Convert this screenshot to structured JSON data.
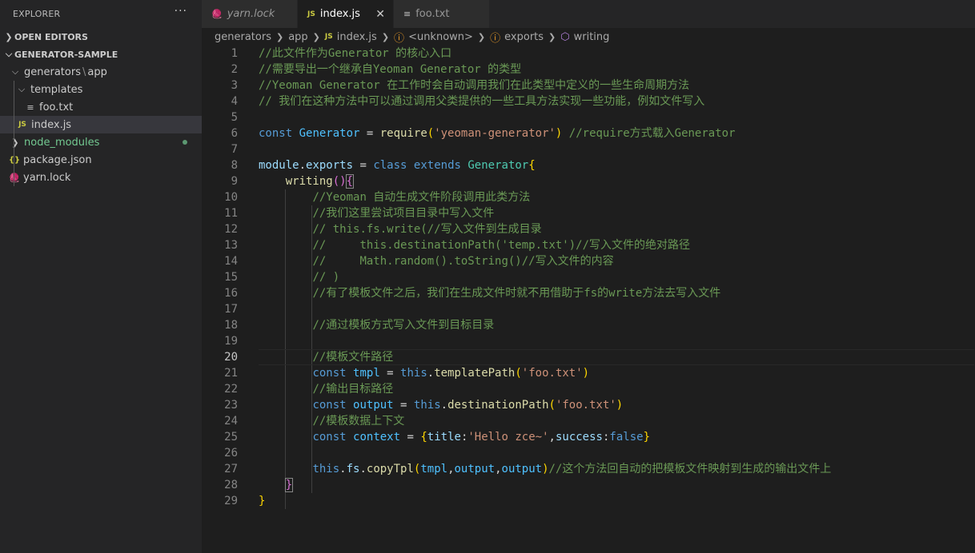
{
  "explorer": {
    "title": "EXPLORER",
    "more": "···",
    "open_editors": "OPEN EDITORS",
    "project": "GENERATOR-SAMPLE",
    "tree": {
      "generators": "generators",
      "sep": "\\",
      "app": "app",
      "templates": "templates",
      "foo_txt": "foo.txt",
      "index_js": "index.js",
      "node_modules": "node_modules",
      "package_json": "package.json",
      "yarn_lock": "yarn.lock"
    }
  },
  "tabs": [
    {
      "label": "yarn.lock",
      "icon": "yarn-icon"
    },
    {
      "label": "index.js",
      "icon": "js-icon",
      "close": "✕"
    },
    {
      "label": "foo.txt",
      "icon": "text-file-icon"
    }
  ],
  "breadcrumb": [
    "generators",
    "app",
    "index.js",
    "<unknown>",
    "exports",
    "writing"
  ],
  "icons": {
    "js": "JS",
    "json": "{}",
    "txt": "≡"
  },
  "editor": {
    "line_numbers": [
      "1",
      "2",
      "3",
      "4",
      "5",
      "6",
      "7",
      "8",
      "9",
      "10",
      "11",
      "12",
      "13",
      "14",
      "15",
      "16",
      "17",
      "18",
      "19",
      "20",
      "21",
      "22",
      "23",
      "24",
      "25",
      "26",
      "27",
      "28",
      "29"
    ],
    "lines": {
      "l1": "//此文件作为Generator 的核心入口",
      "l2": "//需要导出一个继承自Yeoman Generator 的类型",
      "l3": "//Yeoman Generator 在工作时会自动调用我们在此类型中定义的一些生命周期方法",
      "l4": "// 我们在这种方法中可以通过调用父类提供的一些工具方法实现一些功能，例如文件写入",
      "l6_const": "const",
      "l6_name": "Generator",
      "l6_eq": " = ",
      "l6_fn": "require",
      "l6_open": "(",
      "l6_str": "'yeoman-generator'",
      "l6_close": ")",
      "l6_cm": " //require方式载入Generator",
      "l8_module": "module",
      "l8_dot": ".",
      "l8_exports": "exports",
      "l8_eq": " = ",
      "l8_class": "class",
      "l8_extends": "extends",
      "l8_gen": "Generator",
      "l8_brace": "{",
      "l9_fn": "writing",
      "l9_parens": "()",
      "l9_brace": "{",
      "l10": "//Yeoman 自动生成文件阶段调用此类方法",
      "l11": "//我们这里尝试项目目录中写入文件",
      "l12": "// this.fs.write(//写入文件到生成目录",
      "l13": "//     this.destinationPath('temp.txt')//写入文件的绝对路径",
      "l14": "//     Math.random().toString()//写入文件的内容",
      "l15": "// )",
      "l16": "//有了模板文件之后，我们在生成文件时就不用借助于fs的write方法去写入文件",
      "l18": "//通过模板方式写入文件到目标目录",
      "l20": "//模板文件路径",
      "l21_const": "const",
      "l21_var": "tmpl",
      "l21_eq": " = ",
      "l21_this": "this",
      "l21_dot": ".",
      "l21_fn": "templatePath",
      "l21_open": "(",
      "l21_str": "'foo.txt'",
      "l21_close": ")",
      "l22": "//输出目标路径",
      "l23_const": "const",
      "l23_var": "output",
      "l23_eq": " = ",
      "l23_this": "this",
      "l23_dot": ".",
      "l23_fn": "destinationPath",
      "l23_open": "(",
      "l23_str": "'foo.txt'",
      "l23_close": ")",
      "l24": "//模板数据上下文",
      "l25_const": "const",
      "l25_var": "context",
      "l25_eq": " = ",
      "l25_open": "{",
      "l25_k1": "title",
      "l25_colon1": ":",
      "l25_v1": "'Hello zce~'",
      "l25_comma": ",",
      "l25_k2": "success",
      "l25_colon2": ":",
      "l25_v2": "false",
      "l25_close": "}",
      "l27_this": "this",
      "l27_dot1": ".",
      "l27_fs": "fs",
      "l27_dot2": ".",
      "l27_fn": "copyTpl",
      "l27_open": "(",
      "l27_a1": "tmpl",
      "l27_c1": ",",
      "l27_a2": "output",
      "l27_c2": ",",
      "l27_a3": "output",
      "l27_close": ")",
      "l27_cm": "//这个方法回自动的把模板文件映射到生成的输出文件上",
      "l28": "}",
      "l29": "}"
    }
  },
  "colors": {
    "comment": "#6a9955",
    "keyword": "#569cd6",
    "function": "#dcdcaa",
    "string": "#ce9178",
    "class": "#4ec9b0",
    "variable": "#4fc1ff"
  }
}
